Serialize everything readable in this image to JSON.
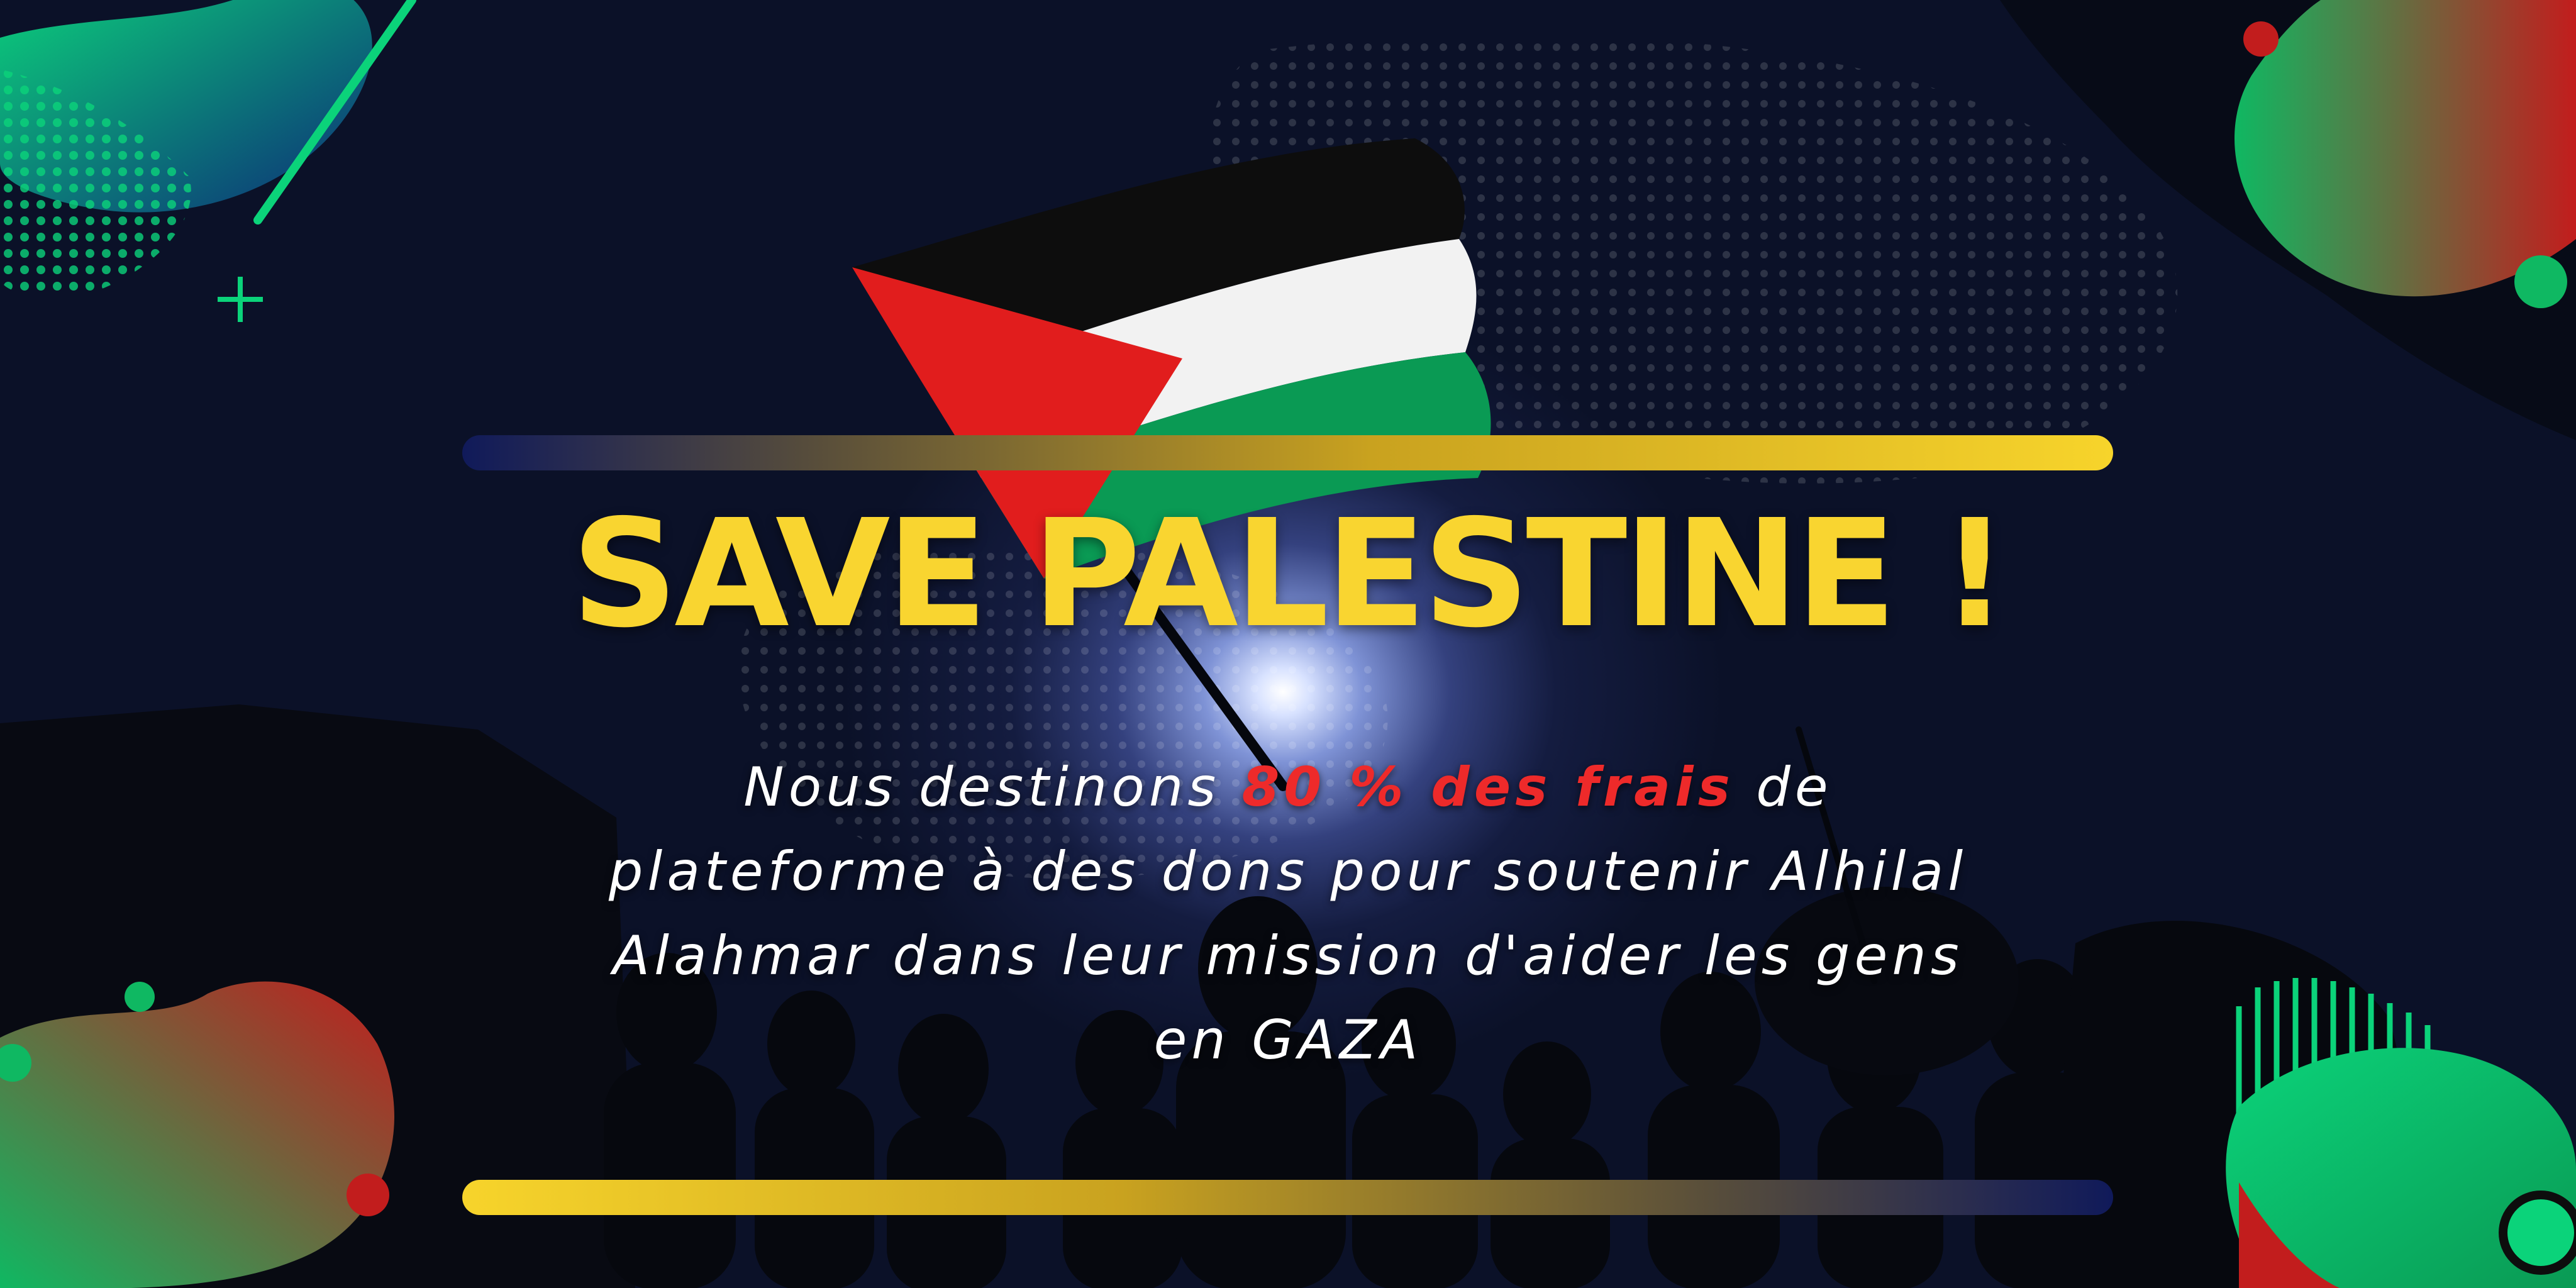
{
  "headline": "SAVE PALESTINE !",
  "message": {
    "part1": "Nous destinons ",
    "highlight": "80 % des frais",
    "part2": " de plateforme à des dons pour soutenir Alhilal Alahmar dans leur mission d'aider les gens en GAZA"
  },
  "colors": {
    "headline": "#f9d530",
    "highlight": "#ee2a2a",
    "flag_black": "#0d0d0d",
    "flag_white": "#f2f2f2",
    "flag_green": "#0a9a54",
    "flag_red": "#e11d1d"
  },
  "icons": [
    "palestine-flag-icon",
    "plus-icon"
  ]
}
